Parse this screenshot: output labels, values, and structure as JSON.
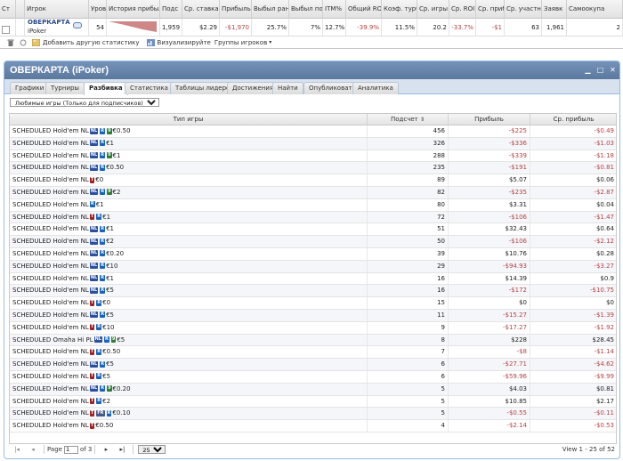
{
  "top_grid": {
    "headers": [
      "Ст",
      "",
      "Игрок",
      "Уров",
      "История прибыл",
      "Подс",
      "Ср. ставка",
      "Прибыль",
      "Выбыл ран",
      "Выбыл по",
      "ITM%",
      "Общий ROI",
      "Коэф. турб",
      "Ср. игры",
      "Ср. ROI",
      "Ср. приб",
      "Ср. участни",
      "Заявк",
      "Самоокупа"
    ],
    "row": {
      "player_name": "ОВЕРКАРТА",
      "player_room": "iPoker",
      "level": "54",
      "count": "1,959",
      "avg_stake": "$2.29",
      "profit": "-$1,970",
      "early_out": "25.7%",
      "late_out": "7%",
      "itm": "12.7%",
      "total_roi": "-39.9%",
      "turbo": "11.5%",
      "avg_game": "20.2",
      "avg_roi": "-33.7%",
      "avg_profit": "-$1",
      "avg_entrants": "63",
      "entries": "1,961",
      "self": "2"
    },
    "toolbar": {
      "add_stat": "Добавить другую статистику",
      "visualize": "Визуализируйте",
      "player_groups": "Группы игроков"
    }
  },
  "panel": {
    "title": "ОВЕРКАРТА (iPoker)",
    "tabs": [
      "Графики",
      "Турниры",
      "Разбивка",
      "Статистика",
      "Таблицы лидеров",
      "Достижения",
      "Найти",
      "Опубликовать",
      "Аналитика"
    ],
    "active_tab": "Разбивка",
    "filter_value": "Любимые игры (Только для подписчиков)",
    "columns": [
      "Тип игры",
      "Подсчет",
      "Прибыль",
      "Ср. прибыль"
    ],
    "rows": [
      {
        "game": "SCHEDULED Hold'em NL",
        "badges": [
          "NL",
          "R",
          "9"
        ],
        "stake": "€0.50",
        "count": "456",
        "profit": "-$225",
        "avg": "-$0.49"
      },
      {
        "game": "SCHEDULED Hold'em NL",
        "badges": [
          "NL",
          "R"
        ],
        "stake": "€1",
        "count": "326",
        "profit": "-$336",
        "avg": "-$1.03"
      },
      {
        "game": "SCHEDULED Hold'em NL",
        "badges": [
          "NL",
          "R",
          "9"
        ],
        "stake": "€1",
        "count": "288",
        "profit": "-$339",
        "avg": "-$1.18"
      },
      {
        "game": "SCHEDULED Hold'em NL",
        "badges": [
          "NL",
          "R"
        ],
        "stake": "€0.50",
        "count": "235",
        "profit": "-$191",
        "avg": "-$0.81"
      },
      {
        "game": "SCHEDULED Hold'em NL",
        "badges": [
          "T"
        ],
        "stake": "€0",
        "count": "89",
        "profit": "$5.07",
        "avg": "$0.06"
      },
      {
        "game": "SCHEDULED Hold'em NL",
        "badges": [
          "NL",
          "R",
          "9"
        ],
        "stake": "€2",
        "count": "82",
        "profit": "-$235",
        "avg": "-$2.87"
      },
      {
        "game": "SCHEDULED Hold'em NL",
        "badges": [
          "R"
        ],
        "stake": "€1",
        "count": "80",
        "profit": "$3.31",
        "avg": "$0.04"
      },
      {
        "game": "SCHEDULED Hold'em NL",
        "badges": [
          "T",
          "R"
        ],
        "stake": "€1",
        "count": "72",
        "profit": "-$106",
        "avg": "-$1.47"
      },
      {
        "game": "SCHEDULED Hold'em NL",
        "badges": [
          "NL",
          "R"
        ],
        "stake": "€1",
        "count": "51",
        "profit": "$32.43",
        "avg": "$0.64"
      },
      {
        "game": "SCHEDULED Hold'em NL",
        "badges": [
          "NL",
          "R"
        ],
        "stake": "€2",
        "count": "50",
        "profit": "-$106",
        "avg": "-$2.12"
      },
      {
        "game": "SCHEDULED Hold'em NL",
        "badges": [
          "NL",
          "R"
        ],
        "stake": "€0.20",
        "count": "39",
        "profit": "$10.76",
        "avg": "$0.28"
      },
      {
        "game": "SCHEDULED Hold'em NL",
        "badges": [
          "NL",
          "R"
        ],
        "stake": "€10",
        "count": "29",
        "profit": "-$94.93",
        "avg": "-$3.27"
      },
      {
        "game": "SCHEDULED Hold'em NL",
        "badges": [
          "NL",
          "R"
        ],
        "stake": "€1",
        "count": "16",
        "profit": "$14.39",
        "avg": "$0.9"
      },
      {
        "game": "SCHEDULED Hold'em NL",
        "badges": [
          "NL",
          "R"
        ],
        "stake": "€5",
        "count": "16",
        "profit": "-$172",
        "avg": "-$10.75"
      },
      {
        "game": "SCHEDULED Hold'em NL",
        "badges": [
          "T",
          "R"
        ],
        "stake": "€0",
        "count": "15",
        "profit": "$0",
        "avg": "$0"
      },
      {
        "game": "SCHEDULED Hold'em NL",
        "badges": [
          "NL",
          "R"
        ],
        "stake": "€5",
        "count": "11",
        "profit": "-$15.27",
        "avg": "-$1.39"
      },
      {
        "game": "SCHEDULED Hold'em NL",
        "badges": [
          "T",
          "R"
        ],
        "stake": "€10",
        "count": "9",
        "profit": "-$17.27",
        "avg": "-$1.92"
      },
      {
        "game": "SCHEDULED Omaha Hi PL",
        "badges": [
          "NL",
          "R",
          "9"
        ],
        "stake": "€5",
        "count": "8",
        "profit": "$228",
        "avg": "$28.45"
      },
      {
        "game": "SCHEDULED Hold'em NL",
        "badges": [
          "T",
          "R"
        ],
        "stake": "€0.50",
        "count": "7",
        "profit": "-$8",
        "avg": "-$1.14"
      },
      {
        "game": "SCHEDULED Hold'em NL",
        "badges": [
          "NL",
          "R"
        ],
        "stake": "€5",
        "count": "6",
        "profit": "-$27.71",
        "avg": "-$4.62"
      },
      {
        "game": "SCHEDULED Hold'em NL",
        "badges": [
          "T",
          "R"
        ],
        "stake": "€5",
        "count": "6",
        "profit": "-$59.96",
        "avg": "-$9.99"
      },
      {
        "game": "SCHEDULED Hold'em NL",
        "badges": [
          "NL",
          "R",
          "9"
        ],
        "stake": "€0.20",
        "count": "5",
        "profit": "$4.03",
        "avg": "$0.81"
      },
      {
        "game": "SCHEDULED Hold'em NL",
        "badges": [
          "T",
          "R"
        ],
        "stake": "€2",
        "count": "5",
        "profit": "$10.85",
        "avg": "$2.17"
      },
      {
        "game": "SCHEDULED Hold'em NL",
        "badges": [
          "T",
          "FR",
          "R"
        ],
        "stake": "€0.10",
        "count": "5",
        "profit": "-$0.55",
        "avg": "-$0.11"
      },
      {
        "game": "SCHEDULED Hold'em NL",
        "badges": [
          "T"
        ],
        "stake": "€0.50",
        "count": "4",
        "profit": "-$2.14",
        "avg": "-$0.53"
      }
    ],
    "pager": {
      "page_label": "Page",
      "page_value": "1",
      "of_label": "of 3",
      "per_page": "25",
      "info": "View 1 - 25 of 52"
    }
  },
  "colors": {
    "panel_header": "#5b789e",
    "negative": "#b54343",
    "player_name": "#2a4a8a"
  }
}
